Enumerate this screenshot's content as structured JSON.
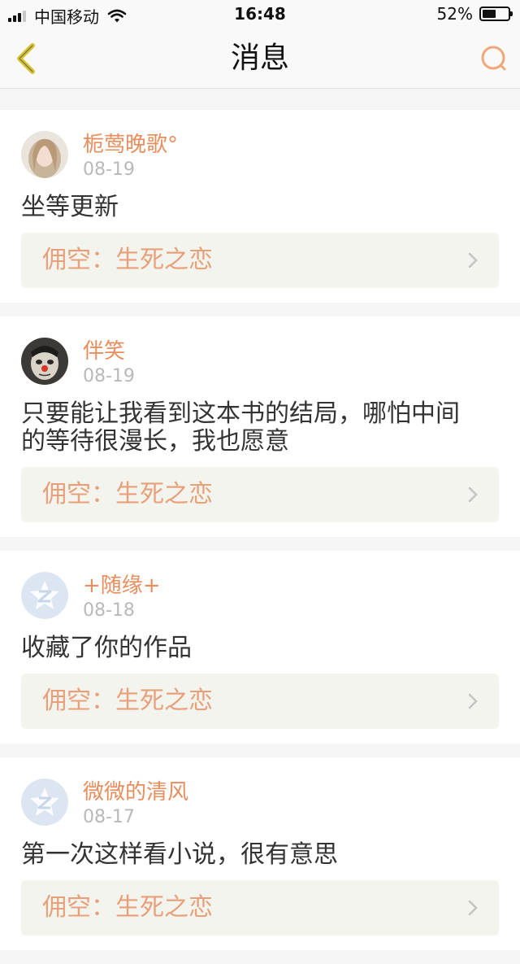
{
  "status": {
    "carrier": "中国移动",
    "time": "16:48",
    "battery": "52%",
    "battery_level": 0.52
  },
  "nav": {
    "title": "消息"
  },
  "messages": [
    {
      "name": "栀莺晚歌°",
      "date": "08-19",
      "content": "坐等更新",
      "book": "佣空：生死之恋"
    },
    {
      "name": "伴笑",
      "date": "08-19",
      "content": "只要能让我看到这本书的结局，哪怕中间的等待很漫长，我也愿意",
      "book": "佣空：生死之恋"
    },
    {
      "name": "+随缘+",
      "date": "08-18",
      "content": "收藏了你的作品",
      "book": "佣空：生死之恋"
    },
    {
      "name": "微微的清风",
      "date": "08-17",
      "content": "第一次这样看小说，很有意思",
      "book": "佣空：生死之恋"
    }
  ],
  "colors": {
    "accent": "#e88d5d",
    "back": "#d6c43a",
    "book_bg": "#f4f4ee"
  }
}
